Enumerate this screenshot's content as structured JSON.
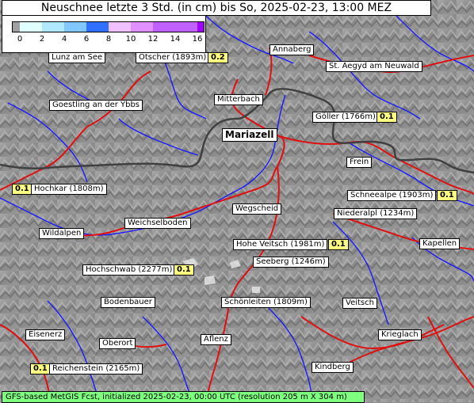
{
  "title": "Neuschnee letzte 3 Std. (in cm) bis So, 2025-02-23, 13:00 MEZ",
  "legend": {
    "ticks": [
      "0",
      "2",
      "4",
      "6",
      "8",
      "10",
      "12",
      "14",
      "16"
    ],
    "colors": [
      "#a0a0a0",
      "#e0ffff",
      "#b0e8ff",
      "#80c8ff",
      "#3070ff",
      "#f0c0ff",
      "#e090ff",
      "#c060ff",
      "#a000ff"
    ]
  },
  "places": {
    "annaberg": "Annaberg",
    "lunz": "Lunz am See",
    "oetscher": "Ötscher (1893m)",
    "st_aegyd": "St. Aegyd am Neuwald",
    "goestling": "Goestling an der Ybbs",
    "mitterbach": "Mitterbach",
    "goeller": "Göller (1766m)",
    "mariazell": "Mariazell",
    "frein": "Frein",
    "hochkar": "Hochkar (1808m)",
    "schneealpe": "Schneealpe (1903m)",
    "wegscheid": "Wegscheid",
    "niederalpl": "Niederalpl (1234m)",
    "weichselboden": "Weichselboden",
    "wildalpen": "Wildalpen",
    "hohe_veitsch": "Hohe Veitsch (1981m)",
    "kapellen": "Kapellen",
    "seeberg": "Seeberg (1246m)",
    "hochschwab": "Hochschwab (2277m)",
    "bodenbauer": "Bodenbauer",
    "schoenleiten": "Schönleiten (1809m)",
    "veitsch": "Veitsch",
    "eisenerz": "Eisenerz",
    "oberort": "Oberort",
    "aflenz": "Aflenz",
    "krieglach": "Krieglach",
    "reichenstein": "Reichenstein (2165m)",
    "kindberg": "Kindberg"
  },
  "values": {
    "oetscher": "0.2",
    "goeller": "0.1",
    "hochkar": "0.1",
    "schneealpe": "0.1",
    "hohe_veitsch": "0.1",
    "hochschwab": "0.1",
    "reichenstein": "0.1"
  },
  "footer": "GFS-based MetGIS Fcst, initialized 2025-02-23, 00:00 UTC  (resolution 205 m X 304 m)",
  "colors": {
    "rivers": "#1a1aff",
    "roads": "#e01010",
    "border": "#404040",
    "value_bg": "#ffff80",
    "footer_bg": "#7fff7f"
  }
}
